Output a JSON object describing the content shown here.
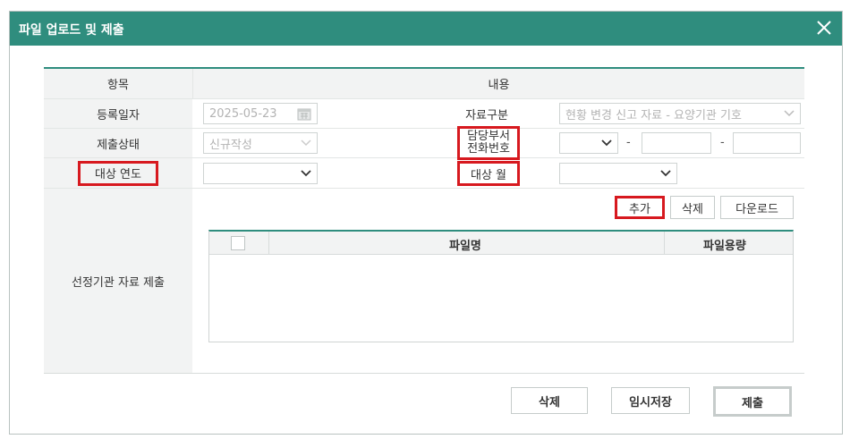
{
  "dialog": {
    "title": "파일 업로드 및 제출",
    "close_icon": "close-icon"
  },
  "form": {
    "header_item": "항목",
    "header_content": "내용",
    "reg_date_label": "등록일자",
    "reg_date_value": "2025-05-23",
    "data_type_label": "자료구분",
    "data_type_value": "현황 변경 신고 자료 - 요양기관 기호",
    "status_label": "제출상태",
    "status_value": "신규작성",
    "phone_label_line1": "담당부서",
    "phone_label_line2": "전화번호",
    "phone_dash": "-",
    "phone_part2": "",
    "phone_part3": "",
    "target_year_label": "대상 연도",
    "target_year_value": "",
    "target_month_label": "대상 월",
    "target_month_value": "",
    "submission_label": "선정기관 자료 제출"
  },
  "file_toolbar": {
    "add_label": "추가",
    "delete_label": "삭제",
    "download_label": "다운로드"
  },
  "file_table": {
    "columns": [
      "파일명",
      "파일용량"
    ],
    "rows": []
  },
  "footer": {
    "delete_label": "삭제",
    "temp_save_label": "임시저장",
    "submit_label": "제출"
  },
  "colors": {
    "accent": "#2f8d7e",
    "highlight": "#d7191f"
  }
}
